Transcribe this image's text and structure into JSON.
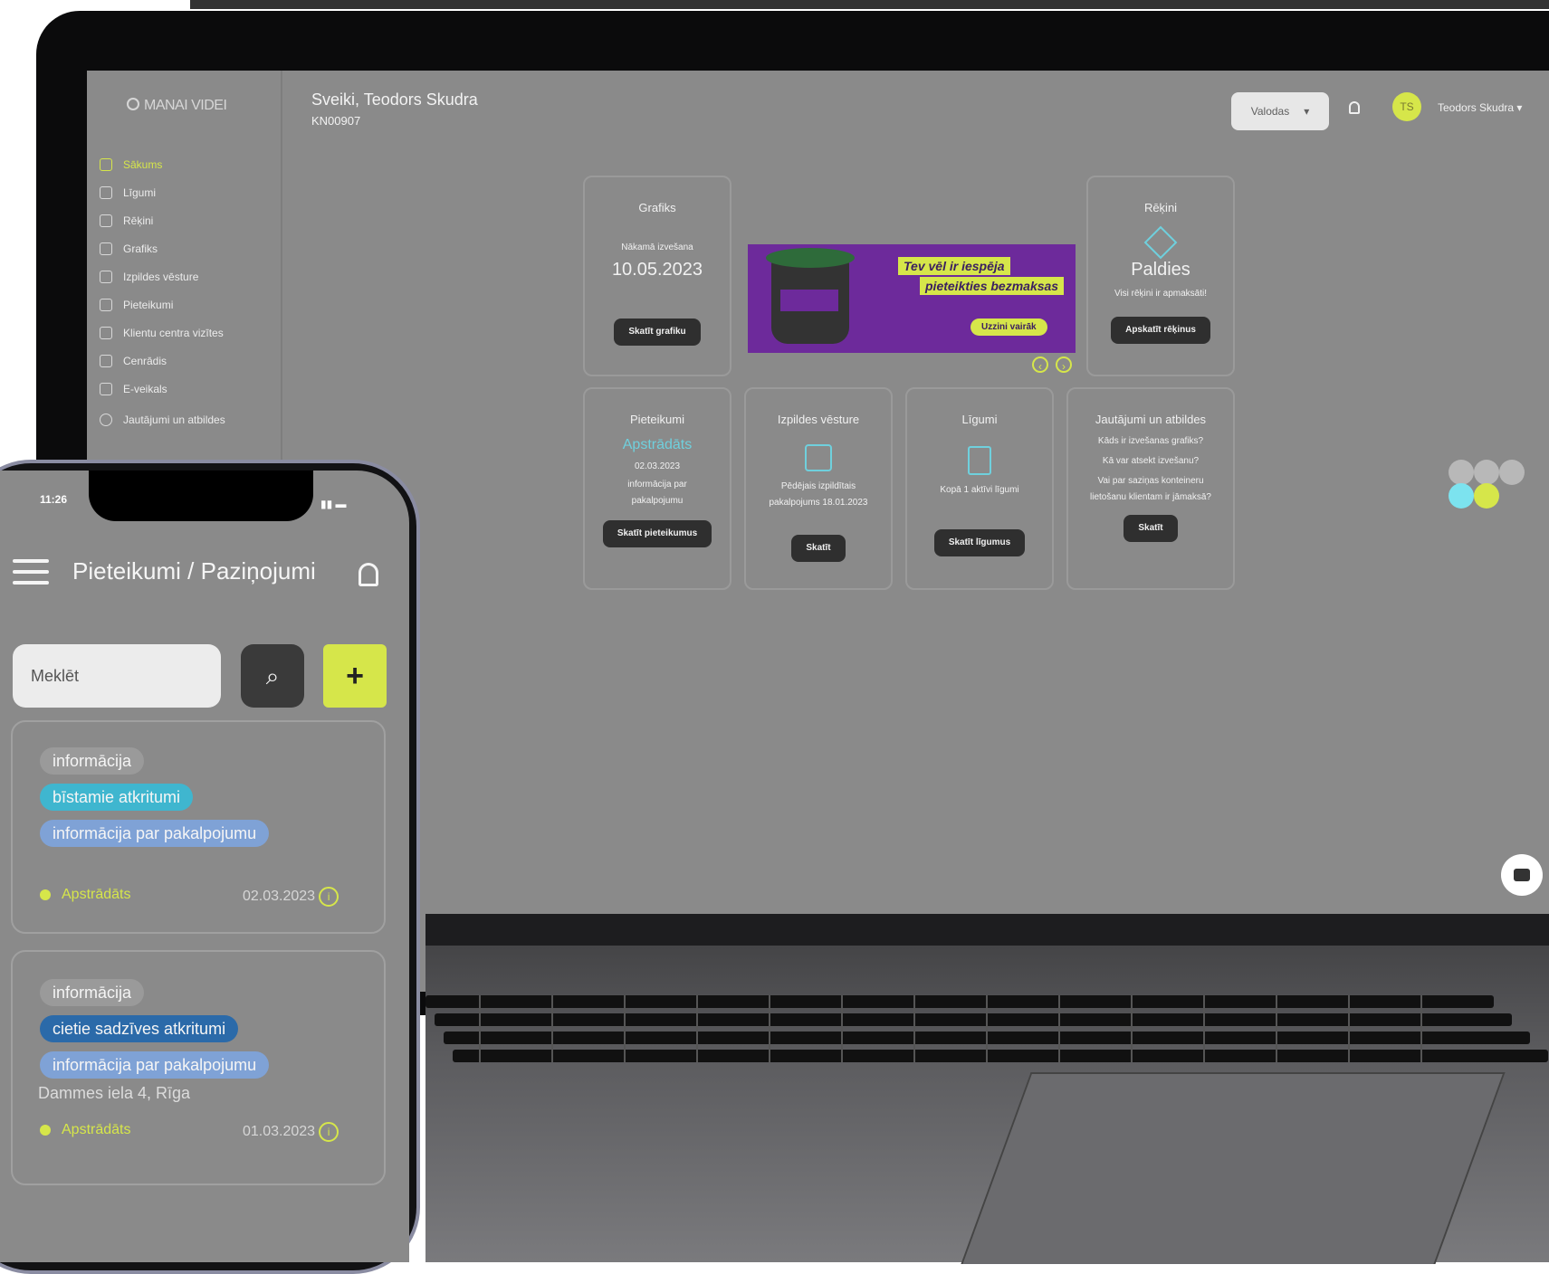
{
  "colors": {
    "accent": "#d6e64a",
    "screen_bg": "#8a8a8a",
    "dark_button": "#2f2f2f",
    "tag_teal": "#3fb6cf",
    "tag_blue": "#7fa2d6",
    "tag_navy": "#2b6aa9"
  },
  "desktop": {
    "logo": "MANAI VIDEI",
    "greeting": "Sveiki, Teodors Skudra",
    "customer_id": "KN00907",
    "language_label": "Valodas",
    "avatar_initials": "TS",
    "user_name": "Teodors Skudra",
    "nav": [
      {
        "label": "Sākums",
        "icon": "dashboard-icon"
      },
      {
        "label": "Līgumi",
        "icon": "contract-icon"
      },
      {
        "label": "Rēķini",
        "icon": "invoice-icon"
      },
      {
        "label": "Grafiks",
        "icon": "calendar-icon"
      },
      {
        "label": "Izpildes vēsture",
        "icon": "history-icon"
      },
      {
        "label": "Pieteikumi",
        "icon": "requests-icon"
      },
      {
        "label": "Klientu centra vizītes",
        "icon": "visits-icon"
      },
      {
        "label": "Cenrādis",
        "icon": "price-tag-icon"
      },
      {
        "label": "E-veikals",
        "icon": "cart-icon"
      },
      {
        "label": "Jautājumi un atbildes",
        "icon": "question-icon"
      }
    ],
    "cards": {
      "schedule": {
        "title": "Grafiks",
        "subtitle": "Nākamā izvešana",
        "date": "10.05.2023",
        "button": "Skatīt grafiku"
      },
      "invoices": {
        "title": "Rēķini",
        "headline": "Paldies",
        "text": "Visi rēķini ir apmaksāti!",
        "button": "Apskatīt rēķinus"
      },
      "requests": {
        "title": "Pieteikumi",
        "status": "Apstrādāts",
        "date": "02.03.2023",
        "text": "informācija par pakalpojumu",
        "button": "Skatīt pieteikumus"
      },
      "history": {
        "title": "Izpildes vēsture",
        "text": "Pēdējais izpildītais pakalpojums 18.01.2023",
        "button": "Skatīt"
      },
      "contracts": {
        "title": "Līgumi",
        "text": "Kopā 1 aktīvi līgumi",
        "button": "Skatīt līgumus"
      },
      "faq": {
        "title": "Jautājumi un atbildes",
        "q1": "Kāds ir izvešanas grafiks?",
        "q2": "Kā var atsekt izvešanu?",
        "q3": "Vai par saziņas konteineru lietošanu klientam ir jāmaksā?",
        "button": "Skatīt"
      }
    },
    "banner": {
      "line1": "Tev vēl ir iespēja",
      "line2": "pieteikties bezmaksas",
      "cta": "Uzzini vairāk"
    }
  },
  "phone": {
    "time": "11:26",
    "title": "Pieteikumi / Paziņojumi",
    "search_placeholder": "Meklēt",
    "add_label": "+",
    "search_icon": "⌕",
    "items": [
      {
        "tags": [
          "informācija",
          "bīstamie atkritumi",
          "informācija par pakalpojumu"
        ],
        "status": "Apstrādāts",
        "date": "02.03.2023"
      },
      {
        "tags": [
          "informācija",
          "cietie sadzīves atkritumi",
          "informācija par pakalpojumu"
        ],
        "address": "Dammes iela 4, Rīga",
        "status": "Apstrādāts",
        "date": "01.03.2023"
      }
    ]
  }
}
